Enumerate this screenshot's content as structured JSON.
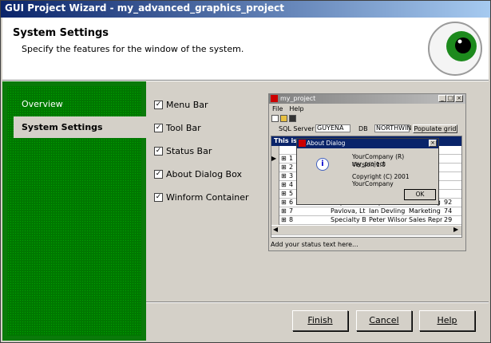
{
  "window": {
    "title": "GUI Project Wizard - my_advanced_graphics_project"
  },
  "header": {
    "title": "System Settings",
    "subtitle": "Specify the features for the window of the system.",
    "image": "eyeball-icon"
  },
  "nav": {
    "items": [
      {
        "label": "Overview",
        "selected": false
      },
      {
        "label": "System Settings",
        "selected": true
      }
    ]
  },
  "options": [
    {
      "label": "Menu Bar",
      "checked": true
    },
    {
      "label": "Tool Bar",
      "checked": true
    },
    {
      "label": "Status Bar",
      "checked": true
    },
    {
      "label": "About Dialog Box",
      "checked": true
    },
    {
      "label": "Winform Container",
      "checked": true
    }
  ],
  "preview": {
    "title": "my_project",
    "menu": [
      "File",
      "Help"
    ],
    "sql_label": "SQL Server",
    "sql_value": "GUYENA",
    "db_label": "DB",
    "db_value": "NORTHWIN",
    "populate": "Populate grid",
    "grid_caption": "This is t",
    "rows": [
      {
        "n": "1",
        "a": "",
        "b": "",
        "c": "",
        "d": ""
      },
      {
        "n": "2",
        "a": "",
        "b": "",
        "c": "",
        "d": ""
      },
      {
        "n": "3",
        "a": "",
        "b": "",
        "c": "",
        "d": ""
      },
      {
        "n": "4",
        "a": "",
        "b": "",
        "c": "",
        "d": ""
      },
      {
        "n": "5",
        "a": "",
        "b": "",
        "c": "",
        "d": ""
      },
      {
        "n": "6",
        "a": "Mayumi's",
        "b": "Mayumi Ohn",
        "c": "Marketing Re",
        "d": "92"
      },
      {
        "n": "7",
        "a": "Pavlova, Ltd.",
        "b": "Ian Devling",
        "c": "Marketing Ma",
        "d": "74"
      },
      {
        "n": "8",
        "a": "Specialty Bis",
        "b": "Peter Wilson",
        "c": "Sales Repres",
        "d": "29"
      }
    ],
    "status": "Add your status text here...",
    "dialog": {
      "title": "About Dialog",
      "line1": "YourCompany (R) my_project",
      "line2": "Version 1.0",
      "line3": "Copyright (C) 2001 YourCompany",
      "ok": "OK"
    }
  },
  "buttons": {
    "finish": "Finish",
    "cancel": "Cancel",
    "help": "Help"
  }
}
